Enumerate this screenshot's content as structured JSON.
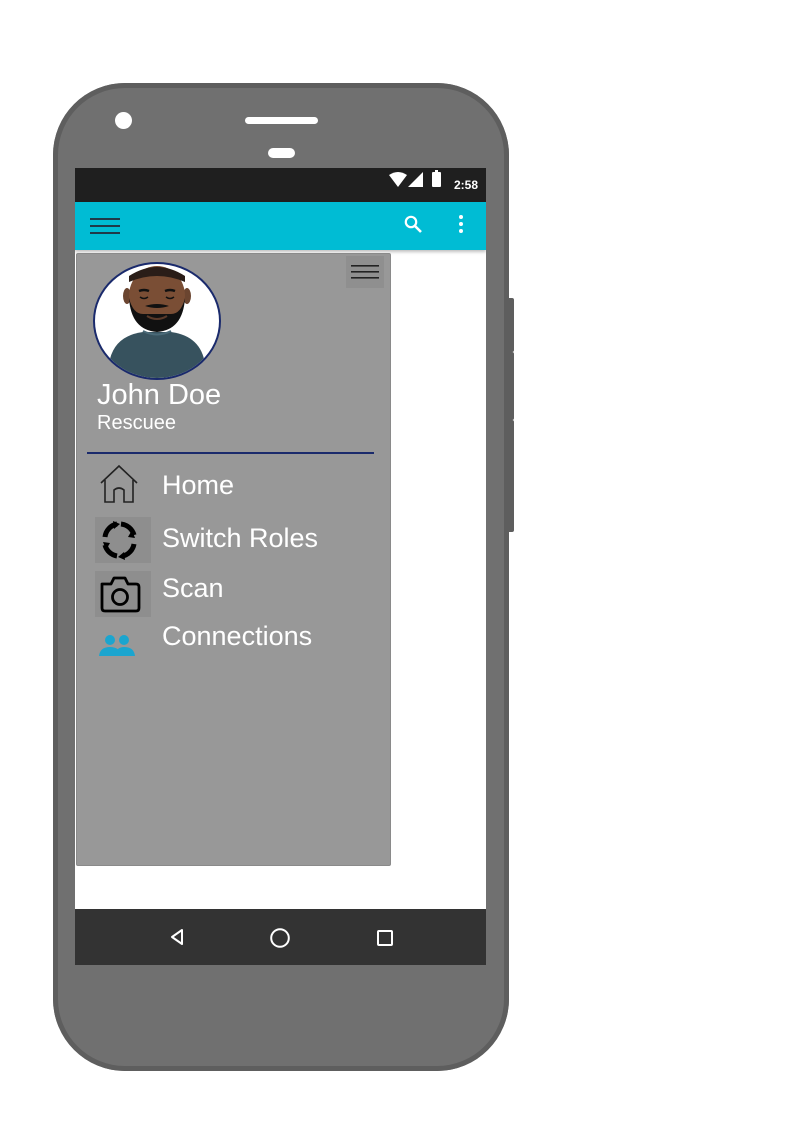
{
  "status_bar": {
    "time": "2:58",
    "icons": [
      "wifi-icon",
      "signal-icon",
      "battery-icon"
    ]
  },
  "app_bar": {
    "color": "#00bcd4",
    "icons": [
      "menu-icon",
      "search-icon",
      "more-vert-icon"
    ]
  },
  "drawer": {
    "user": {
      "name": "John Doe",
      "role": "Rescuee"
    },
    "items": [
      {
        "label": "Home",
        "icon": "home-icon"
      },
      {
        "label": "Switch Roles",
        "icon": "switch-roles-icon"
      },
      {
        "label": "Scan",
        "icon": "camera-icon"
      },
      {
        "label": "Connections",
        "icon": "people-icon"
      }
    ]
  },
  "nav_bar": {
    "icons": [
      "back-icon",
      "home-circle-icon",
      "recents-icon"
    ]
  },
  "colors": {
    "accent": "#00bcd4",
    "drawer_bg": "#989898",
    "divider": "#1a2a6c",
    "connections_icon": "#1ba5cf"
  }
}
